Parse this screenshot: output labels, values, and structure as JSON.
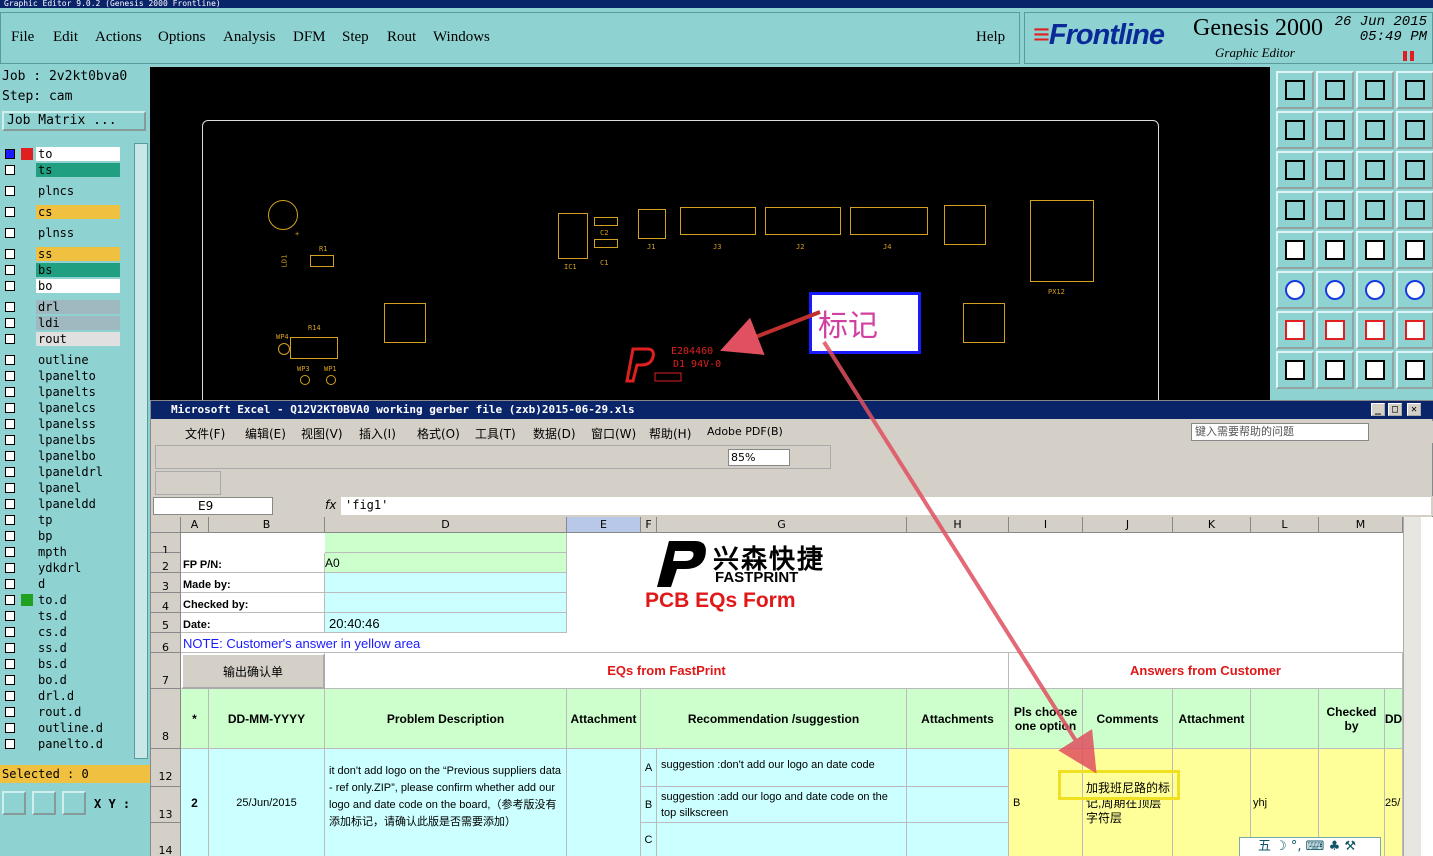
{
  "app": {
    "title": "Graphic Editor 9.0.2 (Genesis 2000 Frontline)",
    "menu": [
      "File",
      "Edit",
      "Actions",
      "Options",
      "Analysis",
      "DFM",
      "Step",
      "Rout",
      "Windows"
    ],
    "help": "Help",
    "brand": {
      "logo": "Frontline",
      "product": "Genesis 2000",
      "subtitle": "Graphic Editor",
      "date": "26 Jun 2015",
      "time": "05:49 PM"
    }
  },
  "left_panel": {
    "job": "Job : 2v2kt0bva0",
    "step": "Step: cam",
    "job_matrix": "Job Matrix ...",
    "layers": [
      {
        "name": "to",
        "color": "#ffffff"
      },
      {
        "name": "ts",
        "color": "#20a080"
      },
      {
        "name": "plncs",
        "color": "#8fd2d2"
      },
      {
        "name": "cs",
        "color": "#f0c040"
      },
      {
        "name": "plnss",
        "color": "#8fd2d2"
      },
      {
        "name": "ss",
        "color": "#f0c040"
      },
      {
        "name": "bs",
        "color": "#20a080"
      },
      {
        "name": "bo",
        "color": "#ffffff"
      },
      {
        "name": "drl",
        "color": "#a0b8c0"
      },
      {
        "name": "ldi",
        "color": "#a0b8c0"
      },
      {
        "name": "rout",
        "color": "#e0e0e0"
      },
      {
        "name": "outline",
        "color": "#8fd2d2"
      },
      {
        "name": "lpanelto",
        "color": "#8fd2d2"
      },
      {
        "name": "lpanelts",
        "color": "#8fd2d2"
      },
      {
        "name": "lpanelcs",
        "color": "#8fd2d2"
      },
      {
        "name": "lpanelss",
        "color": "#8fd2d2"
      },
      {
        "name": "lpanelbs",
        "color": "#8fd2d2"
      },
      {
        "name": "lpanelbo",
        "color": "#8fd2d2"
      },
      {
        "name": "lpaneldrl",
        "color": "#8fd2d2"
      },
      {
        "name": "lpanel",
        "color": "#8fd2d2"
      },
      {
        "name": "lpaneldd",
        "color": "#8fd2d2"
      },
      {
        "name": "tp",
        "color": "#8fd2d2"
      },
      {
        "name": "bp",
        "color": "#8fd2d2"
      },
      {
        "name": "mpth",
        "color": "#8fd2d2"
      },
      {
        "name": "ydkdrl",
        "color": "#8fd2d2"
      },
      {
        "name": "d",
        "color": "#8fd2d2"
      },
      {
        "name": "to.d",
        "color": "#8fd2d2"
      },
      {
        "name": "ts.d",
        "color": "#8fd2d2"
      },
      {
        "name": "cs.d",
        "color": "#8fd2d2"
      },
      {
        "name": "ss.d",
        "color": "#8fd2d2"
      },
      {
        "name": "bs.d",
        "color": "#8fd2d2"
      },
      {
        "name": "bo.d",
        "color": "#8fd2d2"
      },
      {
        "name": "drl.d",
        "color": "#8fd2d2"
      },
      {
        "name": "rout.d",
        "color": "#8fd2d2"
      },
      {
        "name": "outline.d",
        "color": "#8fd2d2"
      },
      {
        "name": "panelto.d",
        "color": "#8fd2d2"
      }
    ],
    "selected": "Selected : 0",
    "xy": "X Y :"
  },
  "canvas": {
    "marker_text": "标记",
    "silk": {
      "c1": "C1",
      "c2": "C2",
      "ic1": "IC1",
      "j1": "J1",
      "j2": "J2",
      "j3": "J3",
      "j4": "J4",
      "r1": "R1",
      "r14": "R14",
      "ld1": "LD1",
      "wp3": "WP3",
      "wp4": "WP4",
      "wp1": "WP1",
      "px12": "PX12",
      "plus": "+"
    },
    "logo_text": {
      "line1": "E204460",
      "line2": "D1  94V-0"
    }
  },
  "excel": {
    "title": "Microsoft Excel - Q12V2KT0BVA0 working gerber file (zxb)2015-06-29.xls",
    "menu": [
      "文件(F)",
      "编辑(E)",
      "视图(V)",
      "插入(I)",
      "格式(O)",
      "工具(T)",
      "数据(D)",
      "窗口(W)",
      "帮助(H)",
      "Adobe PDF(B)"
    ],
    "help_placeholder": "键入需要帮助的问题",
    "zoom": "85%",
    "namebox": "E9",
    "fx": "fx",
    "formula": "'fig1'",
    "columns": [
      "A",
      "B",
      "D",
      "E",
      "F",
      "G",
      "H",
      "I",
      "J",
      "K",
      "L",
      "M"
    ],
    "rows": [
      "1",
      "2",
      "3",
      "4",
      "5",
      "6",
      "7",
      "8",
      "12",
      "13",
      "14"
    ],
    "labels": {
      "fp_pn": "FP P/N:",
      "made_by": "Made by:",
      "checked_by": "Checked by:",
      "date": "Date:",
      "note": "NOTE: Customer's  answer in yellow area",
      "fp_value": "A0",
      "date_value": "20:40:46"
    },
    "button": "输出确认单",
    "logo_cn": "兴森快捷",
    "logo_en": "FASTPRINT",
    "form_title": "PCB EQs Form",
    "eqs_header": "EQs from FastPrint",
    "answers_header": "Answers from Customer",
    "headers": {
      "star": "*",
      "date": "DD-MM-YYYY",
      "problem": "Problem Description",
      "attachment": "Attachment",
      "recommendation": "Recommendation /suggestion",
      "attachments": "Attachments",
      "pls": "Pls choose one option",
      "comments": "Comments",
      "attachment2": "Attachment",
      "checked": "Checked by",
      "dd": "DD"
    },
    "row": {
      "num": "2",
      "date": "25/Jun/2015",
      "problem": "it don't add logo on the “Previous suppliers data - ref only.ZIP”, please confirm whether add our logo and date code on the board,（参考版没有添加标记，请确认此版是否需要添加）",
      "opt_a": "A",
      "opt_b": "B",
      "opt_c": "C",
      "sug_a": "suggestion :don't add our logo an date code",
      "sug_b": "suggestion :add our logo and date code on the top silkscreen",
      "choice": "B",
      "comment": "加我班尼路的标记,周期在顶层字符层",
      "checked": "yhj",
      "dd": "25/"
    },
    "ime": "五 ☽ °, ⌨ ♣ ⚒"
  }
}
